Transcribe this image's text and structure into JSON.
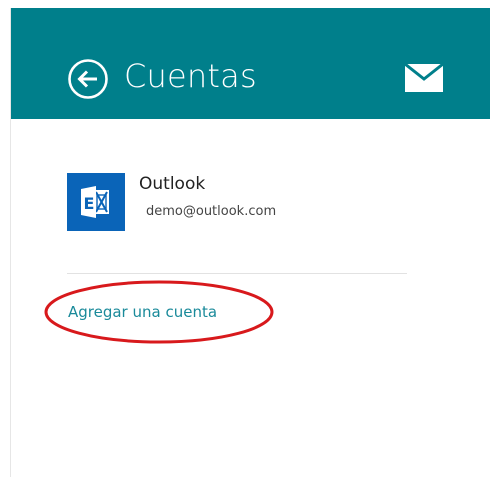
{
  "header": {
    "title": "Cuentas",
    "back_icon": "back-arrow-circle-icon",
    "mail_icon": "mail-envelope-icon",
    "background_color": "#007f8b"
  },
  "accounts": [
    {
      "name": "Outlook",
      "email": "demo@outlook.com",
      "icon": "exchange-icon",
      "tile_color": "#0a64b8"
    }
  ],
  "add_account": {
    "label": "Agregar una cuenta",
    "color": "#1a8a9a"
  },
  "annotation": {
    "type": "ellipse-highlight",
    "color": "#d8191c"
  }
}
